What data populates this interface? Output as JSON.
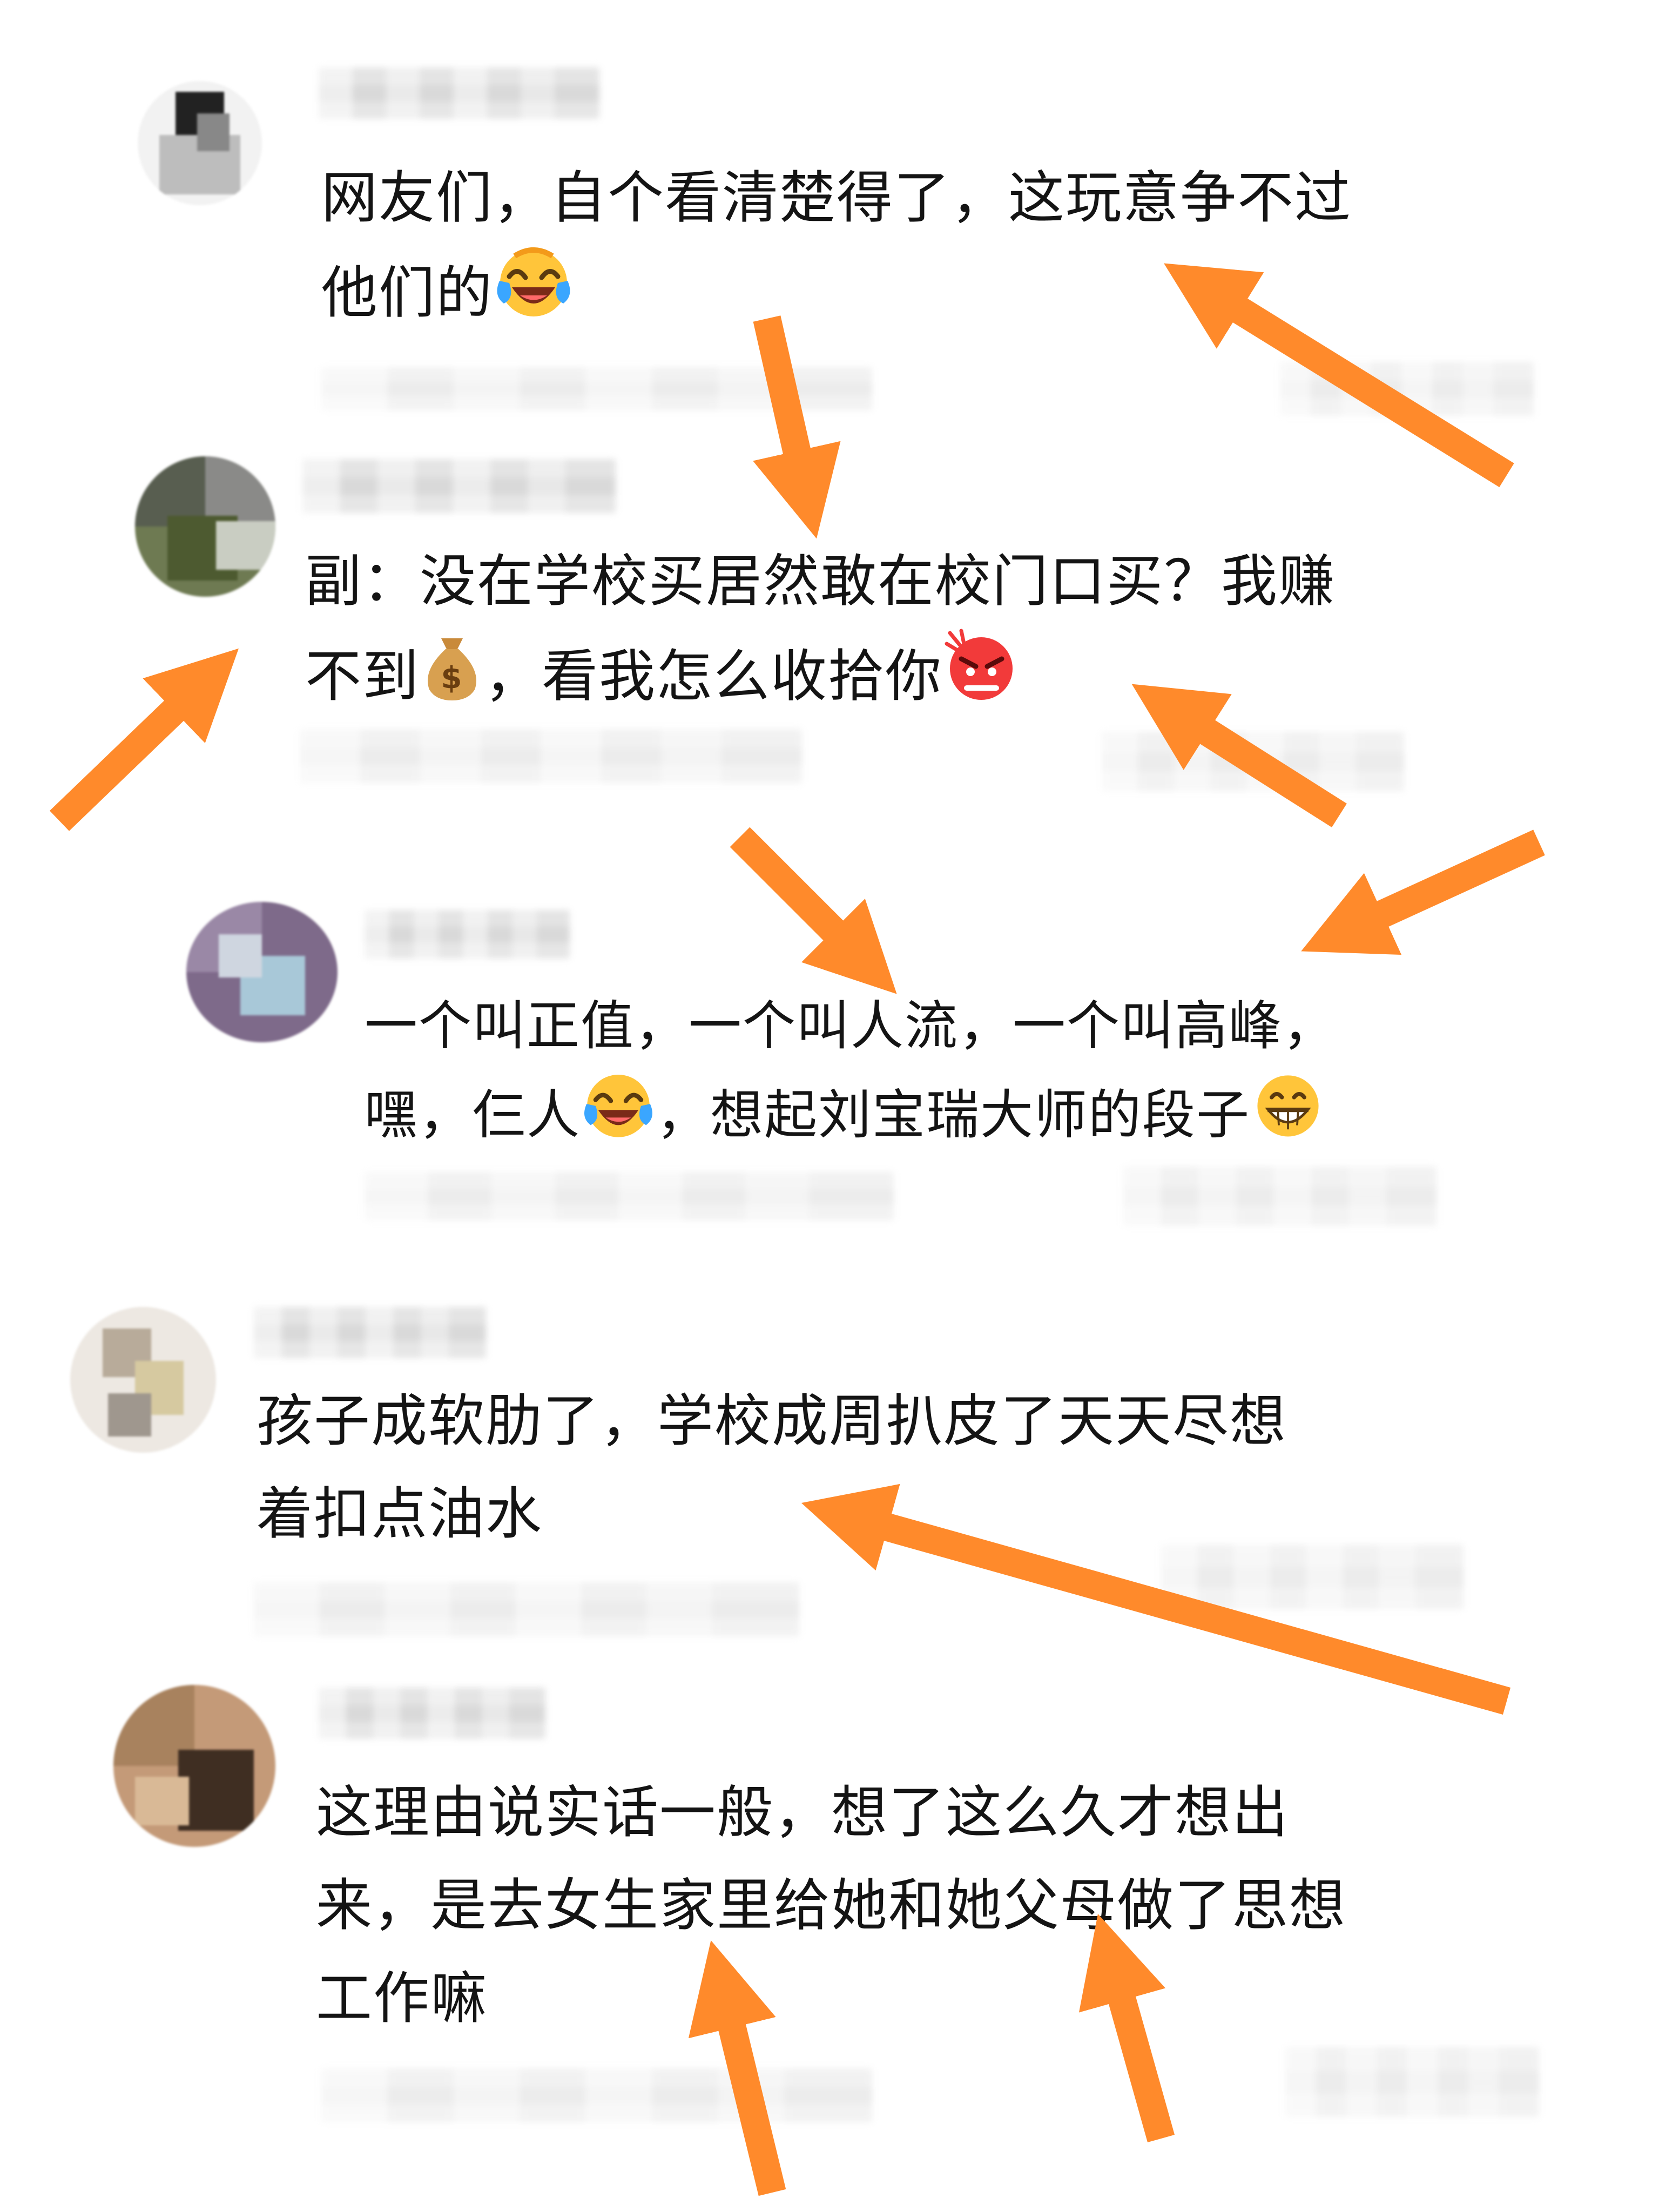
{
  "comments": [
    {
      "id": "c1",
      "lines": [
        "网友们，自个看清楚得了，这玩意争不过",
        "他们的"
      ],
      "trailing_emoji": "crying-laughing",
      "meta_partial": "3分钟"
    },
    {
      "id": "c2",
      "lines": [
        "副：没在学校买居然敢在校门口买？我赚",
        "不到",
        "，看我怎么收拾你"
      ],
      "emoji_inline": "money-bag",
      "trailing_emoji": "angry"
    },
    {
      "id": "c3",
      "lines": [
        "一个叫正值，一个叫人流，一个叫高峰，",
        "嘿，仨人",
        "，想起刘宝瑞大师的段子"
      ],
      "emoji_inline": "crying-laughing",
      "trailing_emoji": "grinning",
      "meta_partial": "10分钟"
    },
    {
      "id": "c4",
      "lines": [
        "孩子成软肋了，学校成周扒皮了天天尽想",
        "着扣点油水"
      ]
    },
    {
      "id": "c5",
      "lines": [
        "这理由说实话一般，想了这么久才想出",
        "来，是去女生家里给她和她父母做了思想",
        "工作嘛"
      ]
    }
  ],
  "colors": {
    "arrow": "#ff8a2b",
    "text": "#141414",
    "background": "#ffffff"
  }
}
